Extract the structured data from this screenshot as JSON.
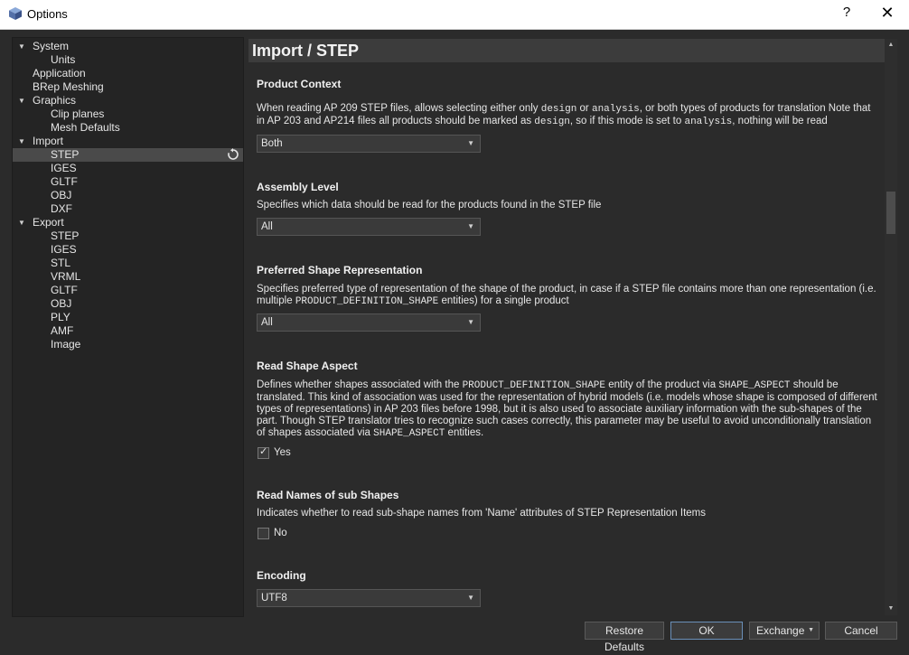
{
  "window": {
    "title": "Options",
    "help_label": "?",
    "close_label": "✕"
  },
  "tree": {
    "items": [
      {
        "label": "System",
        "expanded": true
      },
      {
        "label": "Units"
      },
      {
        "label": "Application"
      },
      {
        "label": "BRep Meshing"
      },
      {
        "label": "Graphics",
        "expanded": true
      },
      {
        "label": "Clip planes"
      },
      {
        "label": "Mesh Defaults"
      },
      {
        "label": "Import",
        "expanded": true
      },
      {
        "label": "STEP",
        "selected": true
      },
      {
        "label": "IGES"
      },
      {
        "label": "GLTF"
      },
      {
        "label": "OBJ"
      },
      {
        "label": "DXF"
      },
      {
        "label": "Export",
        "expanded": true
      },
      {
        "label": "STEP"
      },
      {
        "label": "IGES"
      },
      {
        "label": "STL"
      },
      {
        "label": "VRML"
      },
      {
        "label": "GLTF"
      },
      {
        "label": "OBJ"
      },
      {
        "label": "PLY"
      },
      {
        "label": "AMF"
      },
      {
        "label": "Image"
      }
    ]
  },
  "page": {
    "title": "Import / STEP",
    "product_context": {
      "title": "Product Context",
      "desc_parts": [
        "When reading AP 209 STEP files, allows selecting either only ",
        "design",
        " or ",
        "analysis",
        ", or both types of products for translation Note that in AP 203 and AP214 files all products should be marked as ",
        "design",
        ", so if this mode is set to ",
        "analysis",
        ", nothing will be read"
      ],
      "value": "Both"
    },
    "assembly_level": {
      "title": "Assembly Level",
      "desc": "Specifies which data should be read for the products found in the STEP file",
      "value": "All"
    },
    "preferred_shape": {
      "title": "Preferred Shape Representation",
      "desc_parts": [
        "Specifies preferred type of representation of the shape of the product, in case if a STEP file contains more than one representation (i.e. multiple ",
        "PRODUCT_DEFINITION_SHAPE",
        " entities) for a single product"
      ],
      "value": "All"
    },
    "read_shape_aspect": {
      "title": "Read Shape Aspect",
      "desc_parts": [
        "Defines whether shapes associated with the ",
        "PRODUCT_DEFINITION_SHAPE",
        " entity of the product via ",
        "SHAPE_ASPECT",
        " should be translated. This kind of association was used for the representation of hybrid models (i.e. models whose shape is composed of different types of representations) in AP 203 files before 1998, but it is also used to associate auxiliary information with the sub-shapes of the part. Though STEP translator tries to recognize such cases correctly, this parameter may be useful to avoid unconditionally translation of shapes associated via ",
        "SHAPE_ASPECT",
        " entities."
      ],
      "checked": true,
      "check_label": "Yes"
    },
    "read_names": {
      "title": "Read Names of sub Shapes",
      "desc": "Indicates whether to read sub-shape names from 'Name' attributes of STEP Representation Items",
      "checked": false,
      "check_label": "No"
    },
    "encoding": {
      "title": "Encoding",
      "value": "UTF8"
    }
  },
  "buttons": {
    "restore": "Restore Defaults",
    "ok": "OK",
    "exchange": "Exchange",
    "cancel": "Cancel"
  },
  "colors": {
    "background": "#2b2b2b",
    "tree_bg": "#242424",
    "selected_row": "#4a4a4a",
    "header_bg": "#3c3c3c"
  }
}
